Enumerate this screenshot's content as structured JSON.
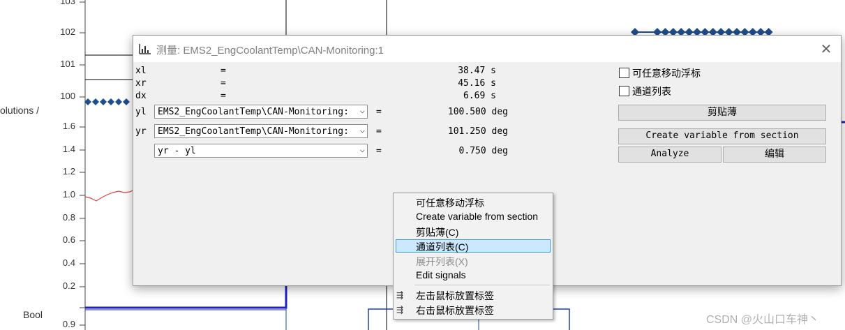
{
  "background": {
    "y_ticks_upper": [
      "103",
      "102",
      "101",
      "100"
    ],
    "y_ticks_lower": [
      "1.6",
      "1.4",
      "1.2",
      "1.0",
      "0.8",
      "0.6",
      "0.4",
      "0.2",
      "0.9"
    ],
    "side_label_revs": "olutions /",
    "side_label_bool": "Bool",
    "colors": {
      "diamond_series": "#1f4e8c",
      "red_trace": "#e04040",
      "bool_trace": "#2020c0"
    }
  },
  "dialog": {
    "title": "测量: EMS2_EngCoolantTemp\\CAN-Monitoring:1",
    "close_icon": "close-icon",
    "rows": [
      {
        "label": "xl",
        "eq": "=",
        "value": "38.47 s"
      },
      {
        "label": "xr",
        "eq": "=",
        "value": "45.16 s"
      },
      {
        "label": "dx",
        "eq": "=",
        "value": "6.69 s"
      }
    ],
    "yl": {
      "label": "yl",
      "combo": "EMS2_EngCoolantTemp\\CAN-Monitoring:",
      "eq": "=",
      "value": "100.500 deg"
    },
    "yr": {
      "label": "yr",
      "combo": "EMS2_EngCoolantTemp\\CAN-Monitoring:",
      "eq": "=",
      "value": "101.250 deg"
    },
    "diff": {
      "combo": "yr - yl",
      "eq": "=",
      "value": "0.750 deg"
    },
    "checkbox_move": "可任意移动浮标",
    "checkbox_channel": "通道列表",
    "btn_clipboard": "剪贴薄",
    "btn_create": "Create variable from section",
    "btn_analyze": "Analyze",
    "btn_edit": "编辑"
  },
  "context_menu": {
    "items": [
      {
        "label": "可任意移动浮标"
      },
      {
        "label": "Create variable from section"
      },
      {
        "label": "剪贴薄(C)"
      },
      {
        "label": "通道列表(C)"
      },
      {
        "label": "展开列表(X)"
      },
      {
        "label": "Edit signals"
      },
      {
        "label": "左击鼠标放置标签"
      },
      {
        "label": "右击鼠标放置标签"
      }
    ],
    "highlight_color": "#cce8ff"
  },
  "watermark": "CSDN @火山口车神丶"
}
